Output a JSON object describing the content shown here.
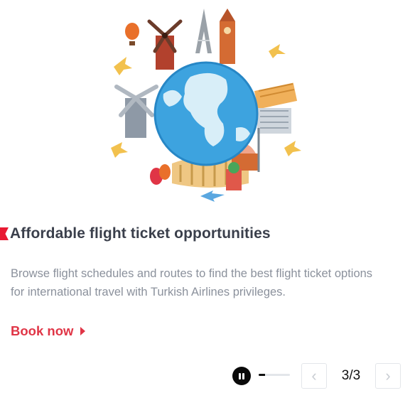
{
  "slide": {
    "title": "Affordable flight ticket opportunities",
    "description": "Browse flight schedules and routes to find the best flight ticket options for international travel with Turkish Airlines privileges.",
    "cta_label": "Book now"
  },
  "carousel": {
    "counter": "3/3",
    "progress": 0.2,
    "prev_icon": "‹",
    "next_icon": "›"
  },
  "colors": {
    "accent": "#e03546",
    "flag": "#e81932",
    "title": "#3a3f4b",
    "body": "#8b919c",
    "globe": "#3da3df",
    "land": "#d8eef8"
  }
}
